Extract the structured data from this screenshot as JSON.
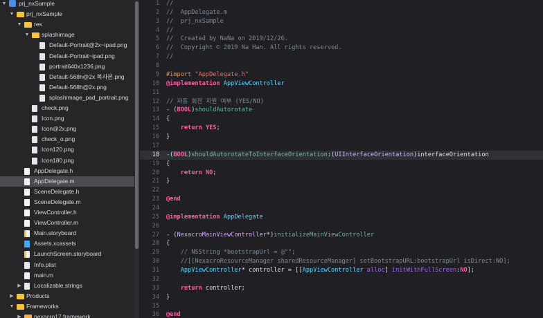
{
  "navigator": {
    "items": [
      {
        "label": "prj_nxSample",
        "depth": 0,
        "icon": "project",
        "expanded": true,
        "selected": false
      },
      {
        "label": "prj_nxSample",
        "depth": 1,
        "icon": "folder",
        "expanded": true,
        "selected": false
      },
      {
        "label": "res",
        "depth": 2,
        "icon": "folder",
        "expanded": true,
        "selected": false
      },
      {
        "label": "splashimage",
        "depth": 3,
        "icon": "folder",
        "expanded": true,
        "selected": false
      },
      {
        "label": "Default-Portrait@2x~ipad.png",
        "depth": 4,
        "icon": "image",
        "selected": false
      },
      {
        "label": "Default-Portrait~ipad.png",
        "depth": 4,
        "icon": "image",
        "selected": false
      },
      {
        "label": "portrait640x1236.png",
        "depth": 4,
        "icon": "image",
        "selected": false
      },
      {
        "label": "Default-568h@2x 복사본.png",
        "depth": 4,
        "icon": "image",
        "selected": false
      },
      {
        "label": "Default-568h@2x.png",
        "depth": 4,
        "icon": "image",
        "selected": false
      },
      {
        "label": "splashimage_pad_portrait.png",
        "depth": 4,
        "icon": "image",
        "selected": false
      },
      {
        "label": "check.png",
        "depth": 3,
        "icon": "image",
        "selected": false
      },
      {
        "label": "Icon.png",
        "depth": 3,
        "icon": "image",
        "selected": false
      },
      {
        "label": "Icon@2x.png",
        "depth": 3,
        "icon": "image",
        "selected": false
      },
      {
        "label": "check_o.png",
        "depth": 3,
        "icon": "image",
        "selected": false
      },
      {
        "label": "Icon120.png",
        "depth": 3,
        "icon": "image",
        "selected": false
      },
      {
        "label": "Icon180.png",
        "depth": 3,
        "icon": "image",
        "selected": false
      },
      {
        "label": "AppDelegate.h",
        "depth": 2,
        "icon": "h",
        "selected": false
      },
      {
        "label": "AppDelegate.m",
        "depth": 2,
        "icon": "m",
        "selected": true
      },
      {
        "label": "SceneDelegate.h",
        "depth": 2,
        "icon": "h",
        "selected": false
      },
      {
        "label": "SceneDelegate.m",
        "depth": 2,
        "icon": "m",
        "selected": false
      },
      {
        "label": "ViewController.h",
        "depth": 2,
        "icon": "h",
        "selected": false
      },
      {
        "label": "ViewController.m",
        "depth": 2,
        "icon": "m",
        "selected": false
      },
      {
        "label": "Main.storyboard",
        "depth": 2,
        "icon": "sb",
        "selected": false
      },
      {
        "label": "Assets.xcassets",
        "depth": 2,
        "icon": "xc",
        "selected": false
      },
      {
        "label": "LaunchScreen.storyboard",
        "depth": 2,
        "icon": "sb",
        "selected": false
      },
      {
        "label": "Info.plist",
        "depth": 2,
        "icon": "plist",
        "selected": false
      },
      {
        "label": "main.m",
        "depth": 2,
        "icon": "m",
        "selected": false
      },
      {
        "label": "Localizable.strings",
        "depth": 2,
        "icon": "strings",
        "expanded": false,
        "selected": false
      },
      {
        "label": "Products",
        "depth": 1,
        "icon": "folder",
        "expanded": false,
        "selected": false
      },
      {
        "label": "Frameworks",
        "depth": 1,
        "icon": "folder",
        "expanded": true,
        "selected": false
      },
      {
        "label": "nexacro17.framework",
        "depth": 2,
        "icon": "fw",
        "expanded": false,
        "selected": false
      }
    ]
  },
  "editor": {
    "current_line": 18,
    "lines": [
      {
        "n": "1",
        "tokens": [
          [
            "com",
            "//"
          ]
        ]
      },
      {
        "n": "2",
        "tokens": [
          [
            "com",
            "//  AppDelegate.m"
          ]
        ]
      },
      {
        "n": "3",
        "tokens": [
          [
            "com",
            "//  prj_nxSample"
          ]
        ]
      },
      {
        "n": "4",
        "tokens": [
          [
            "com",
            "//"
          ]
        ]
      },
      {
        "n": "5",
        "tokens": [
          [
            "com",
            "//  Created by NaNa on 2019/12/26."
          ]
        ]
      },
      {
        "n": "6",
        "tokens": [
          [
            "com",
            "//  Copyright © 2019 Na Han. All rights reserved."
          ]
        ]
      },
      {
        "n": "7",
        "tokens": [
          [
            "com",
            "//"
          ]
        ]
      },
      {
        "n": "8",
        "tokens": []
      },
      {
        "n": "9",
        "tokens": [
          [
            "pre",
            "#import "
          ],
          [
            "str",
            "\"AppDelegate.h\""
          ]
        ]
      },
      {
        "n": "10",
        "tokens": [
          [
            "kw",
            "@implementation"
          ],
          [
            "plain",
            " "
          ],
          [
            "cls",
            "AppViewController"
          ]
        ]
      },
      {
        "n": "11",
        "tokens": []
      },
      {
        "n": "12",
        "tokens": [
          [
            "com",
            "// 자동 회전 지원 여부 (YES/NO)"
          ]
        ]
      },
      {
        "n": "13",
        "tokens": [
          [
            "plain",
            "- ("
          ],
          [
            "kw",
            "BOOL"
          ],
          [
            "plain",
            ")"
          ],
          [
            "fn",
            "shouldAutorotate"
          ]
        ]
      },
      {
        "n": "14",
        "tokens": [
          [
            "plain",
            "{"
          ]
        ]
      },
      {
        "n": "15",
        "tokens": [
          [
            "plain",
            "    "
          ],
          [
            "kw",
            "return"
          ],
          [
            "plain",
            " "
          ],
          [
            "kw",
            "YES"
          ],
          [
            "plain",
            ";"
          ]
        ]
      },
      {
        "n": "16",
        "tokens": [
          [
            "plain",
            "}"
          ]
        ]
      },
      {
        "n": "17",
        "tokens": []
      },
      {
        "n": "18",
        "tokens": [
          [
            "plain",
            "-("
          ],
          [
            "kw",
            "BOOL"
          ],
          [
            "plain",
            ")"
          ],
          [
            "fn",
            "shouldAutorotateToInterfaceOrientation"
          ],
          [
            "plain",
            ":("
          ],
          [
            "type",
            "UIInterfaceOrientation"
          ],
          [
            "plain",
            ")interfaceOrientation"
          ]
        ]
      },
      {
        "n": "19",
        "tokens": [
          [
            "plain",
            "{"
          ]
        ]
      },
      {
        "n": "20",
        "tokens": [
          [
            "plain",
            "    "
          ],
          [
            "kw",
            "return"
          ],
          [
            "plain",
            " "
          ],
          [
            "kw",
            "NO"
          ],
          [
            "plain",
            ";"
          ]
        ]
      },
      {
        "n": "21",
        "tokens": [
          [
            "plain",
            "}"
          ]
        ]
      },
      {
        "n": "22",
        "tokens": []
      },
      {
        "n": "23",
        "tokens": [
          [
            "kw",
            "@end"
          ]
        ]
      },
      {
        "n": "24",
        "tokens": []
      },
      {
        "n": "25",
        "tokens": [
          [
            "kw",
            "@implementation"
          ],
          [
            "plain",
            " "
          ],
          [
            "cls",
            "AppDelegate"
          ]
        ]
      },
      {
        "n": "26",
        "tokens": []
      },
      {
        "n": "27",
        "tokens": [
          [
            "plain",
            "- ("
          ],
          [
            "type",
            "NexacroMainViewController"
          ],
          [
            "plain",
            "*)"
          ],
          [
            "fn",
            "initializeMainViewController"
          ]
        ]
      },
      {
        "n": "28",
        "tokens": [
          [
            "plain",
            "{"
          ]
        ]
      },
      {
        "n": "29",
        "tokens": [
          [
            "plain",
            "    "
          ],
          [
            "com",
            "// NSString *bootstrapUrl = @\"\";"
          ]
        ]
      },
      {
        "n": "30",
        "tokens": [
          [
            "plain",
            "    "
          ],
          [
            "com",
            "//[[NexacroResourceManager sharedResourceManager] setBootstrapURL:bootstrapUrl isDirect:NO];"
          ]
        ]
      },
      {
        "n": "31",
        "tokens": [
          [
            "plain",
            "    "
          ],
          [
            "cls",
            "AppViewController"
          ],
          [
            "plain",
            "* controller = [["
          ],
          [
            "cls",
            "AppViewController"
          ],
          [
            "plain",
            " "
          ],
          [
            "id",
            "alloc"
          ],
          [
            "plain",
            "] "
          ],
          [
            "id",
            "initWithFullScreen"
          ],
          [
            "plain",
            ":"
          ],
          [
            "kw",
            "NO"
          ],
          [
            "plain",
            "];"
          ]
        ]
      },
      {
        "n": "32",
        "tokens": []
      },
      {
        "n": "33",
        "tokens": [
          [
            "plain",
            "    "
          ],
          [
            "kw",
            "return"
          ],
          [
            "plain",
            " controller;"
          ]
        ]
      },
      {
        "n": "34",
        "tokens": [
          [
            "plain",
            "}"
          ]
        ]
      },
      {
        "n": "35",
        "tokens": []
      },
      {
        "n": "36",
        "tokens": [
          [
            "kw",
            "@end"
          ]
        ]
      }
    ]
  },
  "colors": {
    "comment": "#7f8c98",
    "keyword": "#fc5fa3",
    "preprocessor": "#fd8f3f",
    "string": "#fc6a5d",
    "type": "#d0a8ff",
    "class": "#5dd8ff",
    "function": "#67b7a4",
    "selection": "#4b4b50"
  }
}
